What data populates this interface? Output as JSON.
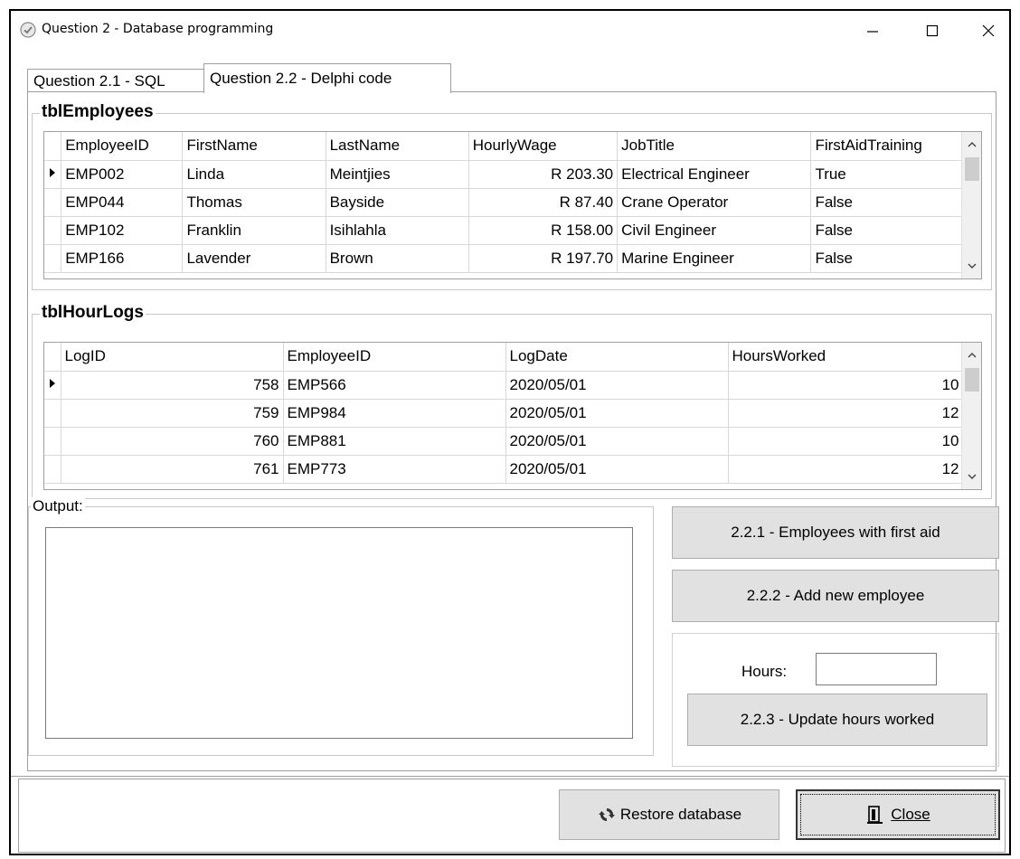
{
  "window": {
    "title": "Question 2 - Database  programming"
  },
  "tabs": [
    {
      "label": "Question 2.1 - SQL"
    },
    {
      "label": "Question 2.2 - Delphi code"
    }
  ],
  "employees": {
    "title": "tblEmployees",
    "columns": [
      "EmployeeID",
      "FirstName",
      "LastName",
      "HourlyWage",
      "JobTitle",
      "FirstAidTraining"
    ],
    "rows": [
      [
        "EMP002",
        "Linda",
        "Meintjies",
        "R 203.30",
        "Electrical Engineer",
        "True"
      ],
      [
        "EMP044",
        "Thomas",
        "Bayside",
        "R 87.40",
        "Crane Operator",
        "False"
      ],
      [
        "EMP102",
        "Franklin",
        "Isihlahla",
        "R 158.00",
        "Civil Engineer",
        "False"
      ],
      [
        "EMP166",
        "Lavender",
        "Brown",
        "R 197.70",
        "Marine Engineer",
        "False"
      ]
    ]
  },
  "hourlogs": {
    "title": "tblHourLogs",
    "columns": [
      "LogID",
      "EmployeeID",
      "LogDate",
      "HoursWorked"
    ],
    "rows": [
      [
        "758",
        "EMP566",
        "2020/05/01",
        "10"
      ],
      [
        "759",
        "EMP984",
        "2020/05/01",
        "12"
      ],
      [
        "760",
        "EMP881",
        "2020/05/01",
        "10"
      ],
      [
        "761",
        "EMP773",
        "2020/05/01",
        "12"
      ]
    ]
  },
  "output": {
    "label": "Output:",
    "text": ""
  },
  "buttons": {
    "first_aid": "2.2.1 - Employees with first aid",
    "add_employee": "2.2.2 -  Add new employee",
    "update_hours": "2.2.3 - Update hours worked",
    "restore": "Restore database",
    "close": "Close"
  },
  "hours": {
    "label": "Hours:",
    "value": ""
  }
}
